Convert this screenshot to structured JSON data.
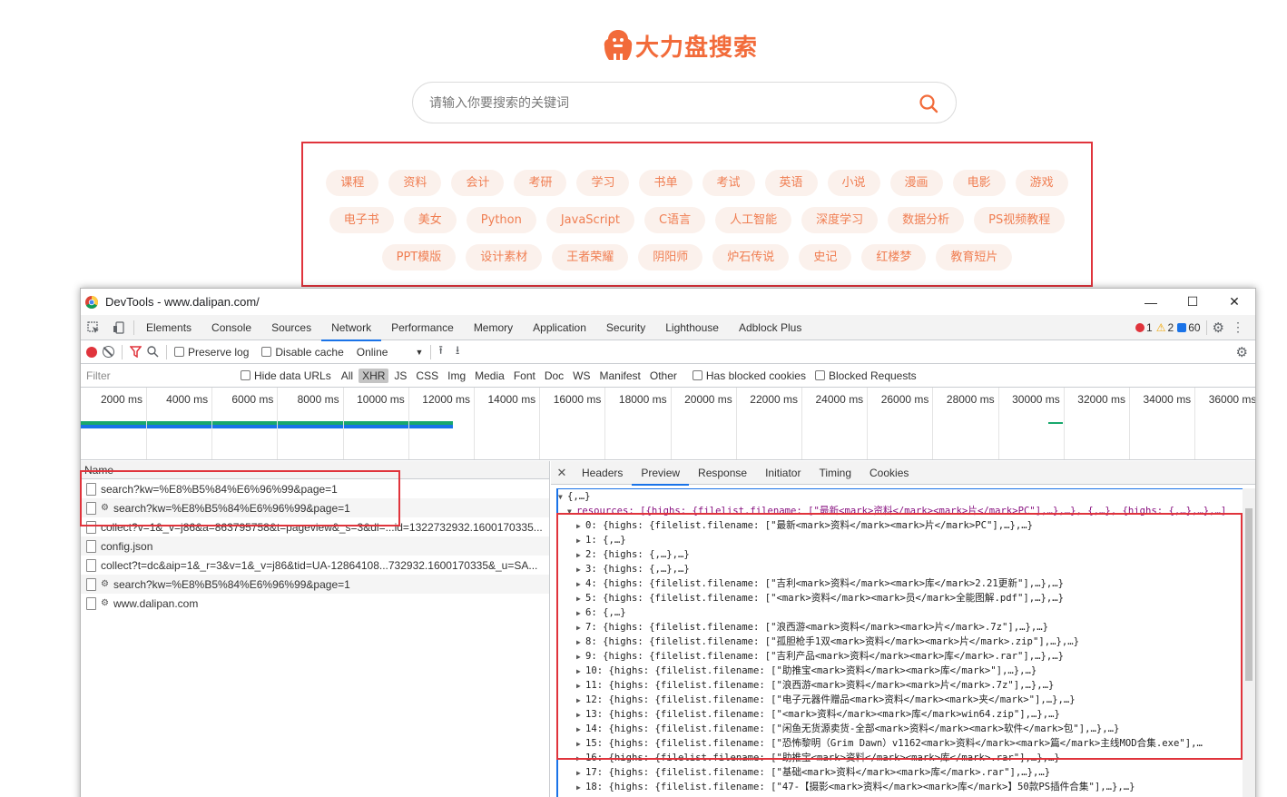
{
  "site": {
    "logo_text": "大力盘搜索",
    "search_placeholder": "请输入你要搜索的关键词",
    "tags": [
      [
        "课程",
        "资料",
        "会计",
        "考研",
        "学习",
        "书单",
        "考试",
        "英语",
        "小说",
        "漫画",
        "电影",
        "游戏"
      ],
      [
        "电子书",
        "美女",
        "Python",
        "JavaScript",
        "C语言",
        "人工智能",
        "深度学习",
        "数据分析",
        "PS视频教程"
      ],
      [
        "PPT模版",
        "设计素材",
        "王者荣耀",
        "阴阳师",
        "炉石传说",
        "史记",
        "红楼梦",
        "教育短片"
      ]
    ],
    "accent": "#f26b3a"
  },
  "devtools": {
    "title": "DevTools - www.dalipan.com/",
    "controls": {
      "minimize": "—",
      "maximize": "☐",
      "close": "✕"
    },
    "panel_tabs": [
      "Elements",
      "Console",
      "Sources",
      "Network",
      "Performance",
      "Memory",
      "Application",
      "Security",
      "Lighthouse",
      "Adblock Plus"
    ],
    "active_panel": "Network",
    "errors": "1",
    "warnings": "2",
    "messages": "60",
    "toolbar": {
      "preserve_log": "Preserve log",
      "disable_cache": "Disable cache",
      "throttling": "Online"
    },
    "filter": {
      "placeholder": "Filter",
      "hide_data_urls": "Hide data URLs",
      "types": [
        "All",
        "XHR",
        "JS",
        "CSS",
        "Img",
        "Media",
        "Font",
        "Doc",
        "WS",
        "Manifest",
        "Other"
      ],
      "active_type": "XHR",
      "has_blocked_cookies": "Has blocked cookies",
      "blocked_requests": "Blocked Requests"
    },
    "overview_ticks": [
      "2000 ms",
      "4000 ms",
      "6000 ms",
      "8000 ms",
      "10000 ms",
      "12000 ms",
      "14000 ms",
      "16000 ms",
      "18000 ms",
      "20000 ms",
      "22000 ms",
      "24000 ms",
      "26000 ms",
      "28000 ms",
      "30000 ms",
      "32000 ms",
      "34000 ms",
      "36000 ms"
    ],
    "list_header": "Name",
    "requests": [
      {
        "name": "search?kw=%E8%B5%84%E6%96%99&page=1",
        "gear": false
      },
      {
        "name": "search?kw=%E8%B5%84%E6%96%99&page=1",
        "gear": true
      },
      {
        "name": "collect?v=1&_v=j86&a=863795758&t=pageview&_s=3&dl=...id=1322732932.1600170335...",
        "gear": false
      },
      {
        "name": "config.json",
        "gear": false
      },
      {
        "name": "collect?t=dc&aip=1&_r=3&v=1&_v=j86&tid=UA-12864108...732932.1600170335&_u=SA...",
        "gear": false
      },
      {
        "name": "search?kw=%E8%B5%84%E6%96%99&page=1",
        "gear": true
      },
      {
        "name": "www.dalipan.com",
        "gear": true
      }
    ],
    "detail_tabs": [
      "Headers",
      "Preview",
      "Response",
      "Initiator",
      "Timing",
      "Cookies"
    ],
    "active_detail_tab": "Preview",
    "preview": {
      "root": "{,…}",
      "resources_line": "resources: [{highs: {filelist.filename: [\"最新<mark>资料</mark><mark>片</mark>PC\"],…},…}, {,…}, {highs: {,…},…},…]",
      "items": [
        "0: {highs: {filelist.filename: [\"最新<mark>资料</mark><mark>片</mark>PC\"],…},…}",
        "1: {,…}",
        "2: {highs: {,…},…}",
        "3: {highs: {,…},…}",
        "4: {highs: {filelist.filename: [\"吉利<mark>资料</mark><mark>库</mark>2.21更新\"],…},…}",
        "5: {highs: {filelist.filename: [\"<mark>资料</mark><mark>员</mark>全能图解.pdf\"],…},…}",
        "6: {,…}",
        "7: {highs: {filelist.filename: [\"浪西游<mark>资料</mark><mark>片</mark>.7z\"],…},…}",
        "8: {highs: {filelist.filename: [\"孤胆枪手1双<mark>资料</mark><mark>片</mark>.zip\"],…},…}",
        "9: {highs: {filelist.filename: [\"吉利产品<mark>资料</mark><mark>库</mark>.rar\"],…},…}",
        "10: {highs: {filelist.filename: [\"助推宝<mark>资料</mark><mark>库</mark>\"],…},…}",
        "11: {highs: {filelist.filename: [\"浪西游<mark>资料</mark><mark>片</mark>.7z\"],…},…}",
        "12: {highs: {filelist.filename: [\"电子元器件赠品<mark>资料</mark><mark>夹</mark>\"],…},…}",
        "13: {highs: {filelist.filename: [\"<mark>资料</mark><mark>库</mark>win64.zip\"],…},…}",
        "14: {highs: {filelist.filename: [\"闲鱼无货源卖货-全部<mark>资料</mark><mark>软件</mark>包\"],…},…}",
        "15: {highs: {filelist.filename: [\"恐怖黎明（Grim Dawn）v1162<mark>资料</mark><mark>篇</mark>主线MOD合集.exe\"],…",
        "16: {highs: {filelist.filename: [\"助推宝<mark>资料</mark><mark>库</mark>.rar\"],…},…}",
        "17: {highs: {filelist.filename: [\"基础<mark>资料</mark><mark>库</mark>.rar\"],…},…}",
        "18: {highs: {filelist.filename: [\"47-【摄影<mark>资料</mark><mark>库</mark>】50款PS插件合集\"],…},…}"
      ]
    }
  }
}
